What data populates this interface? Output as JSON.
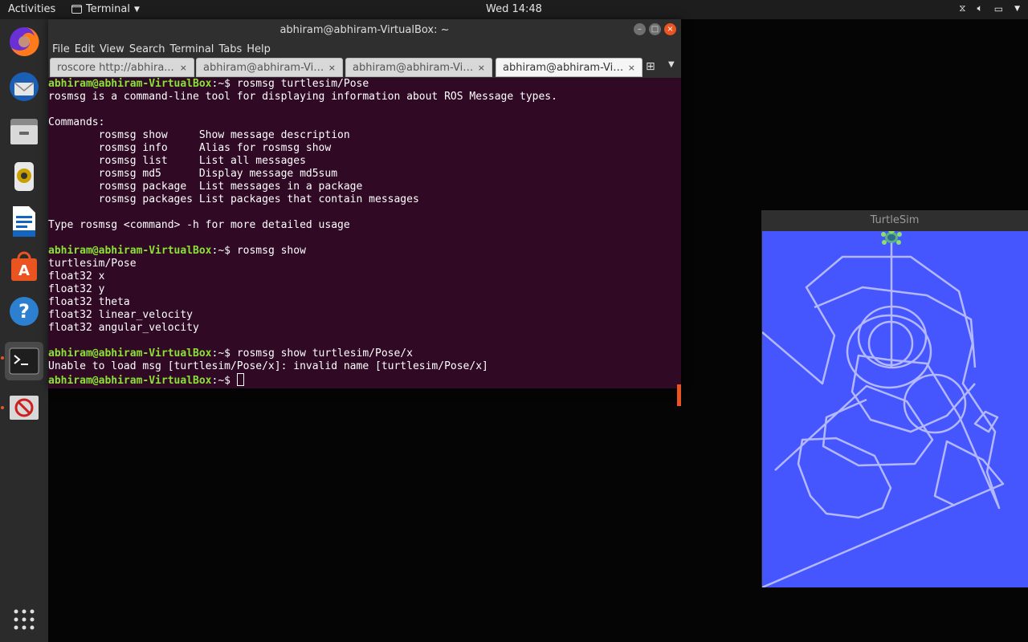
{
  "topbar": {
    "activities": "Activities",
    "app_name": "Terminal",
    "clock": "Wed 14:48",
    "tray_icons": [
      "network-icon",
      "volume-icon",
      "battery-icon"
    ]
  },
  "dock": {
    "items": [
      "firefox-icon",
      "thunderbird-icon",
      "files-icon",
      "rhythmbox-icon",
      "writer-icon",
      "software-icon",
      "help-icon",
      "terminal-icon",
      "virtualbox-icon",
      "apps-grid-icon"
    ]
  },
  "terminal": {
    "title": "abhiram@abhiram-VirtualBox: ~",
    "menu": [
      "File",
      "Edit",
      "View",
      "Search",
      "Terminal",
      "Tabs",
      "Help"
    ],
    "tabs": [
      {
        "label": "roscore http://abhira...",
        "close": "×"
      },
      {
        "label": "abhiram@abhiram-Vir...",
        "close": "×"
      },
      {
        "label": "abhiram@abhiram-Vir...",
        "close": "×"
      },
      {
        "label": "abhiram@abhiram-Vir...",
        "close": "×"
      }
    ],
    "prompt": "abhiram@abhiram-VirtualBox",
    "prompt_suffix": ":~$ ",
    "cmd1": "rosmsg turtlesim/Pose",
    "out1": [
      "rosmsg is a command-line tool for displaying information about ROS Message types.",
      "",
      "Commands:",
      "        rosmsg show     Show message description",
      "        rosmsg info     Alias for rosmsg show",
      "        rosmsg list     List all messages",
      "        rosmsg md5      Display message md5sum",
      "        rosmsg package  List messages in a package",
      "        rosmsg packages List packages that contain messages",
      "",
      "Type rosmsg <command> -h for more detailed usage",
      ""
    ],
    "cmd2": "rosmsg show",
    "out2": [
      "turtlesim/Pose",
      "float32 x",
      "float32 y",
      "float32 theta",
      "float32 linear_velocity",
      "float32 angular_velocity",
      ""
    ],
    "cmd3": "rosmsg show turtlesim/Pose/x",
    "out3": [
      "Unable to load msg [turtlesim/Pose/x]: invalid name [turtlesim/Pose/x]"
    ]
  },
  "turtlesim": {
    "title": "TurtleSim",
    "background": "#4556ff",
    "path_color": "#b3b8ff"
  }
}
